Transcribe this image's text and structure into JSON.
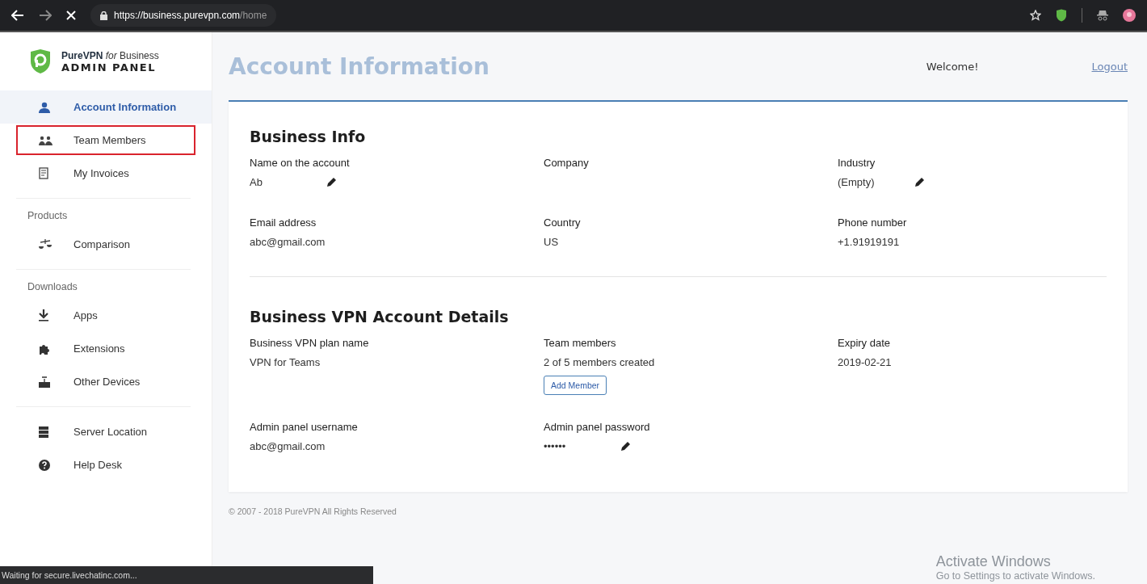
{
  "browser": {
    "url_host": "https://business.purevpn.com",
    "url_path": "/home",
    "status": "Waiting for secure.livechatinc.com..."
  },
  "brand": {
    "name": "PureVPN",
    "for": "for",
    "business": "Business",
    "panel": "ADMIN PANEL"
  },
  "sidebar": {
    "groups": [
      {
        "items": [
          {
            "label": "Account Information",
            "kind": "person",
            "selected": true,
            "highlighted": false
          },
          {
            "label": "Team Members",
            "kind": "people",
            "selected": false,
            "highlighted": true
          },
          {
            "label": "My Invoices",
            "kind": "invoice",
            "selected": false,
            "highlighted": false
          }
        ]
      },
      {
        "heading": "Products",
        "items": [
          {
            "label": "Comparison",
            "kind": "scales",
            "selected": false,
            "highlighted": false
          }
        ]
      },
      {
        "heading": "Downloads",
        "items": [
          {
            "label": "Apps",
            "kind": "download",
            "selected": false,
            "highlighted": false
          },
          {
            "label": "Extensions",
            "kind": "puzzle",
            "selected": false,
            "highlighted": false
          },
          {
            "label": "Other Devices",
            "kind": "router",
            "selected": false,
            "highlighted": false
          }
        ]
      },
      {
        "items": [
          {
            "label": "Server Location",
            "kind": "server",
            "selected": false,
            "highlighted": false
          },
          {
            "label": "Help Desk",
            "kind": "help",
            "selected": false,
            "highlighted": false
          }
        ]
      }
    ]
  },
  "header": {
    "title": "Account Information",
    "welcome": "Welcome!",
    "logout": "Logout"
  },
  "sections": [
    {
      "title": "Business Info",
      "fields": [
        {
          "label": "Name on the account",
          "value": "Ab",
          "editable": true
        },
        {
          "label": "Company",
          "editable": false
        },
        {
          "label": "Industry",
          "value": "(Empty)",
          "editable": true
        },
        {
          "label": "Email address",
          "value": "abc@gmail.com",
          "editable": false
        },
        {
          "label": "Country",
          "value": "US",
          "editable": false
        },
        {
          "label": "Phone number",
          "value": "+1.91919191",
          "editable": false
        }
      ]
    },
    {
      "title": "Business VPN Account Details",
      "fields": [
        {
          "label": "Business VPN plan name",
          "value": "VPN for Teams",
          "editable": false
        },
        {
          "label": "Team members",
          "value": "2 of 5 members created",
          "button": "Add Member",
          "editable": false
        },
        {
          "label": "Expiry date",
          "value": "2019-02-21",
          "editable": false
        },
        {
          "label": "Admin panel username",
          "value": "abc@gmail.com",
          "editable": false
        },
        {
          "label": "Admin panel password",
          "value": "••••••",
          "editable": true
        }
      ]
    }
  ],
  "footer": "© 2007 - 2018 PureVPN All Rights Reserved",
  "watermark": {
    "title": "Activate Windows",
    "text": "Go to Settings to activate Windows."
  }
}
